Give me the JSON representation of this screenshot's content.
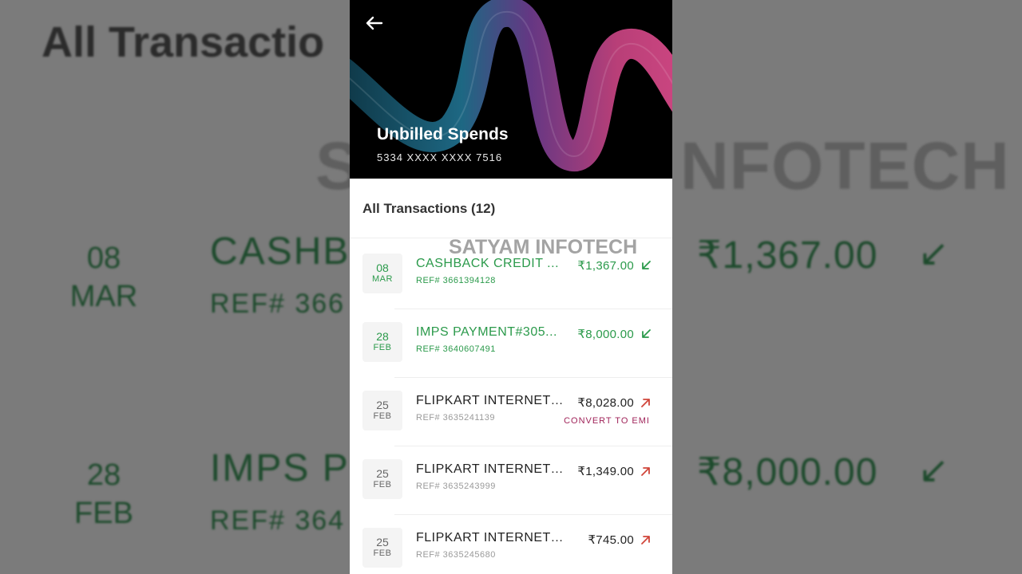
{
  "backdrop": {
    "title": "All Transactio",
    "brand": "S",
    "brand2": "NFOTECH",
    "rows": [
      {
        "day": "08",
        "month": "MAR",
        "desc": "CASHB",
        "ref": "REF# 366",
        "amount": "₹1,367.00",
        "arrow": "↙"
      },
      {
        "day": "28",
        "month": "FEB",
        "desc": "IMPS P",
        "ref": "REF# 364",
        "amount": "₹8,000.00",
        "arrow": "↙"
      }
    ]
  },
  "header": {
    "title": "Unbilled Spends",
    "card_number": "5334 XXXX XXXX 7516"
  },
  "section": {
    "title": "All Transactions (12)"
  },
  "watermark": "SATYAM INFOTECH",
  "transactions": [
    {
      "day": "08",
      "month": "MAR",
      "description": "CASHBACK CREDIT ...",
      "ref": "REF# 3661394128",
      "amount": "₹1,367.00",
      "type": "credit"
    },
    {
      "day": "28",
      "month": "FEB",
      "description": "IMPS PAYMENT#305...",
      "ref": "REF# 3640607491",
      "amount": "₹8,000.00",
      "type": "credit"
    },
    {
      "day": "25",
      "month": "FEB",
      "description": "FLIPKART INTERNET ...",
      "ref": "REF# 3635241139",
      "amount": "₹8,028.00",
      "type": "debit",
      "emi_label": "CONVERT TO EMI"
    },
    {
      "day": "25",
      "month": "FEB",
      "description": "FLIPKART INTERNET ...",
      "ref": "REF# 3635243999",
      "amount": "₹1,349.00",
      "type": "debit"
    },
    {
      "day": "25",
      "month": "FEB",
      "description": "FLIPKART INTERNET P...",
      "ref": "REF# 3635245680",
      "amount": "₹745.00",
      "type": "debit"
    }
  ],
  "colors": {
    "credit": "#2b9a4b",
    "debit_arrow": "#d0453a",
    "emi": "#a0245a"
  }
}
